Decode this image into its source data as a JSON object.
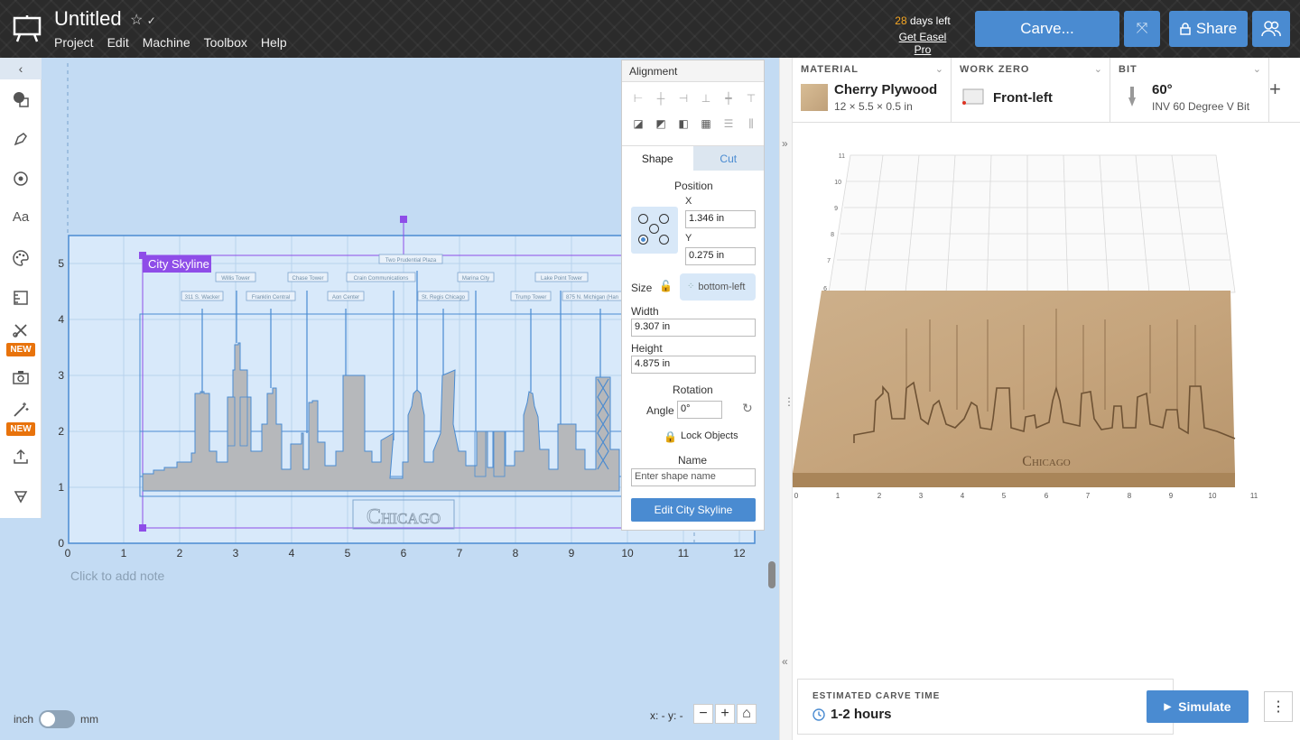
{
  "project": {
    "title": "Untitled"
  },
  "menu": [
    "Project",
    "Edit",
    "Machine",
    "Toolbox",
    "Help"
  ],
  "trial": {
    "days": "28",
    "days_suffix": " days left",
    "link": "Get Easel Pro"
  },
  "actions": {
    "carve": "Carve...",
    "share": "Share"
  },
  "left_toolbar": {
    "new_badge_1": "NEW",
    "new_badge_2": "NEW"
  },
  "canvas": {
    "shape_label": "City Skyline",
    "chicago": "Chicago",
    "x_ticks": [
      "0",
      "1",
      "2",
      "3",
      "4",
      "5",
      "6",
      "7",
      "8",
      "9",
      "10",
      "11",
      "12"
    ],
    "y_ticks": [
      "0",
      "1",
      "2",
      "3",
      "4",
      "5"
    ],
    "building_labels": [
      "311 S. Wacker",
      "Willis Tower",
      "Franklin Central",
      "Chase Tower",
      "Aon Center",
      "Crain Communications",
      "Two Prudential Plaza",
      "St. Regis Chicago",
      "Marina City",
      "Trump Tower",
      "Lake Point Tower",
      "875 N. Michigan (Han"
    ],
    "note": "Click to add note",
    "coords": "x: - y: -"
  },
  "units": {
    "left": "inch",
    "right": "mm"
  },
  "panel": {
    "alignment": "Alignment",
    "tab_shape": "Shape",
    "tab_cut": "Cut",
    "position": "Position",
    "x_label": "X",
    "x_value": "1.346 in",
    "y_label": "Y",
    "y_value": "0.275 in",
    "size": "Size",
    "anchor": "bottom-left",
    "width_label": "Width",
    "width_value": "9.307 in",
    "height_label": "Height",
    "height_value": "4.875 in",
    "rotation": "Rotation",
    "angle_label": "Angle",
    "angle_value": "0°",
    "lock": "Lock Objects",
    "name_label": "Name",
    "name_placeholder": "Enter shape name",
    "edit_button": "Edit City Skyline"
  },
  "settings": {
    "material_label": "MATERIAL",
    "material_name": "Cherry Plywood",
    "material_size": "12 × 5.5 × 0.5 in",
    "workzero_label": "WORK ZERO",
    "workzero_value": "Front-left",
    "bit_label": "BIT",
    "bit_angle": "60°",
    "bit_name": "INV 60 Degree V Bit"
  },
  "preview": {
    "x_ticks": [
      "0",
      "1",
      "2",
      "3",
      "4",
      "5",
      "6",
      "7",
      "8",
      "9",
      "10",
      "11"
    ],
    "y_ticks": [
      "6",
      "7",
      "8",
      "9",
      "10",
      "11"
    ],
    "chicago": "Chicago"
  },
  "estimate": {
    "label": "ESTIMATED CARVE TIME",
    "value": "1-2 hours",
    "simulate": "Simulate"
  },
  "colors": {
    "accent": "#4a8bd1",
    "new_badge": "#e8730c",
    "selection": "#8e4de8",
    "wood": "#c9ab84"
  }
}
